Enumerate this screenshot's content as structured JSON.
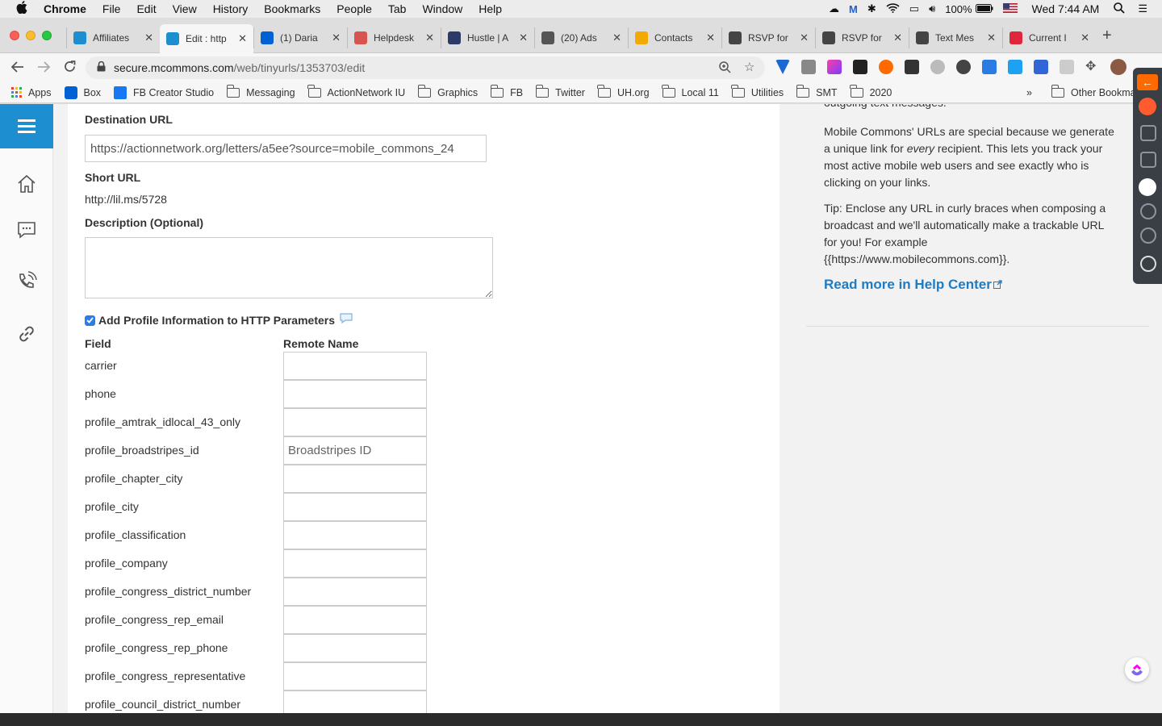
{
  "menubar": {
    "apple": "",
    "items": [
      "Chrome",
      "File",
      "Edit",
      "View",
      "History",
      "Bookmarks",
      "People",
      "Tab",
      "Window",
      "Help"
    ],
    "battery": "100%",
    "clock": "Wed 7:44 AM"
  },
  "tabs": [
    {
      "title": "Affiliates",
      "favicon_color": "#1d8ed0"
    },
    {
      "title": "Edit : http",
      "favicon_color": "#1d8ed0"
    },
    {
      "title": "(1) Daria",
      "favicon_color": "#0061d5"
    },
    {
      "title": "Helpdesk",
      "favicon_color": "#d9534f"
    },
    {
      "title": "Hustle | A",
      "favicon_color": "#2b3a67"
    },
    {
      "title": "(20) Ads",
      "favicon_color": "#555555"
    },
    {
      "title": "Contacts",
      "favicon_color": "#f2a900"
    },
    {
      "title": "RSVP for",
      "favicon_color": "#444444"
    },
    {
      "title": "RSVP for",
      "favicon_color": "#444444"
    },
    {
      "title": "Text Mes",
      "favicon_color": "#444444"
    },
    {
      "title": "Current I",
      "favicon_color": "#e0263a"
    }
  ],
  "omnibox": {
    "host": "secure.mcommons.com",
    "path": "/web/tinyurls/1353703/edit"
  },
  "bookmarks": [
    {
      "label": "Apps",
      "kind": "apps"
    },
    {
      "label": "Box",
      "kind": "box"
    },
    {
      "label": "FB Creator Studio",
      "kind": "fb"
    },
    {
      "label": "Messaging",
      "kind": "folder"
    },
    {
      "label": "ActionNetwork IU",
      "kind": "folder"
    },
    {
      "label": "Graphics",
      "kind": "folder"
    },
    {
      "label": "FB",
      "kind": "folder"
    },
    {
      "label": "Twitter",
      "kind": "folder"
    },
    {
      "label": "UH.org",
      "kind": "folder"
    },
    {
      "label": "Local 11",
      "kind": "folder"
    },
    {
      "label": "Utilities",
      "kind": "folder"
    },
    {
      "label": "SMT",
      "kind": "folder"
    },
    {
      "label": "2020",
      "kind": "folder"
    }
  ],
  "bookmarks_overflow": "»",
  "other_bookmarks": "Other Bookmarks",
  "form": {
    "destination_label": "Destination URL",
    "destination_value": "https://actionnetwork.org/letters/a5ee?source=mobile_commons_24",
    "short_url_label": "Short URL",
    "short_url_value": "http://lil.ms/5728",
    "description_label": "Description (Optional)",
    "description_value": "",
    "profile_checkbox_label": "Add Profile Information to HTTP Parameters",
    "profile_checkbox_checked": true,
    "field_header": "Field",
    "remote_header": "Remote Name",
    "rows": [
      {
        "field": "carrier",
        "remote": ""
      },
      {
        "field": "phone",
        "remote": ""
      },
      {
        "field": "profile_amtrak_idlocal_43_only",
        "remote": ""
      },
      {
        "field": "profile_broadstripes_id",
        "remote": "Broadstripes ID"
      },
      {
        "field": "profile_chapter_city",
        "remote": ""
      },
      {
        "field": "profile_city",
        "remote": ""
      },
      {
        "field": "profile_classification",
        "remote": ""
      },
      {
        "field": "profile_company",
        "remote": ""
      },
      {
        "field": "profile_congress_district_number",
        "remote": ""
      },
      {
        "field": "profile_congress_rep_email",
        "remote": ""
      },
      {
        "field": "profile_congress_rep_phone",
        "remote": ""
      },
      {
        "field": "profile_congress_representative",
        "remote": ""
      },
      {
        "field": "profile_council_district_number",
        "remote": ""
      }
    ]
  },
  "help": {
    "para1_line1": "Mobile Commons' URLs are special because we generate",
    "para1_line2a": "a unique link for ",
    "para1_emph": "every",
    "para1_line2b": " recipient. This lets you track your",
    "para1_line3": "most active mobile web users and see exactly who is",
    "para1_line4": "clicking on your links.",
    "para2_line1": "Tip: Enclose any URL in curly braces when composing a",
    "para2_line2": "broadcast and we'll automatically make a trackable URL",
    "para2_line3": "for you! For example",
    "para2_line4": "{{https://www.mobilecommons.com}}.",
    "read_more": "Read more in Help Center"
  },
  "colors": {
    "brand_blue": "#1d8ed0",
    "link_blue": "#1d7cc4"
  }
}
